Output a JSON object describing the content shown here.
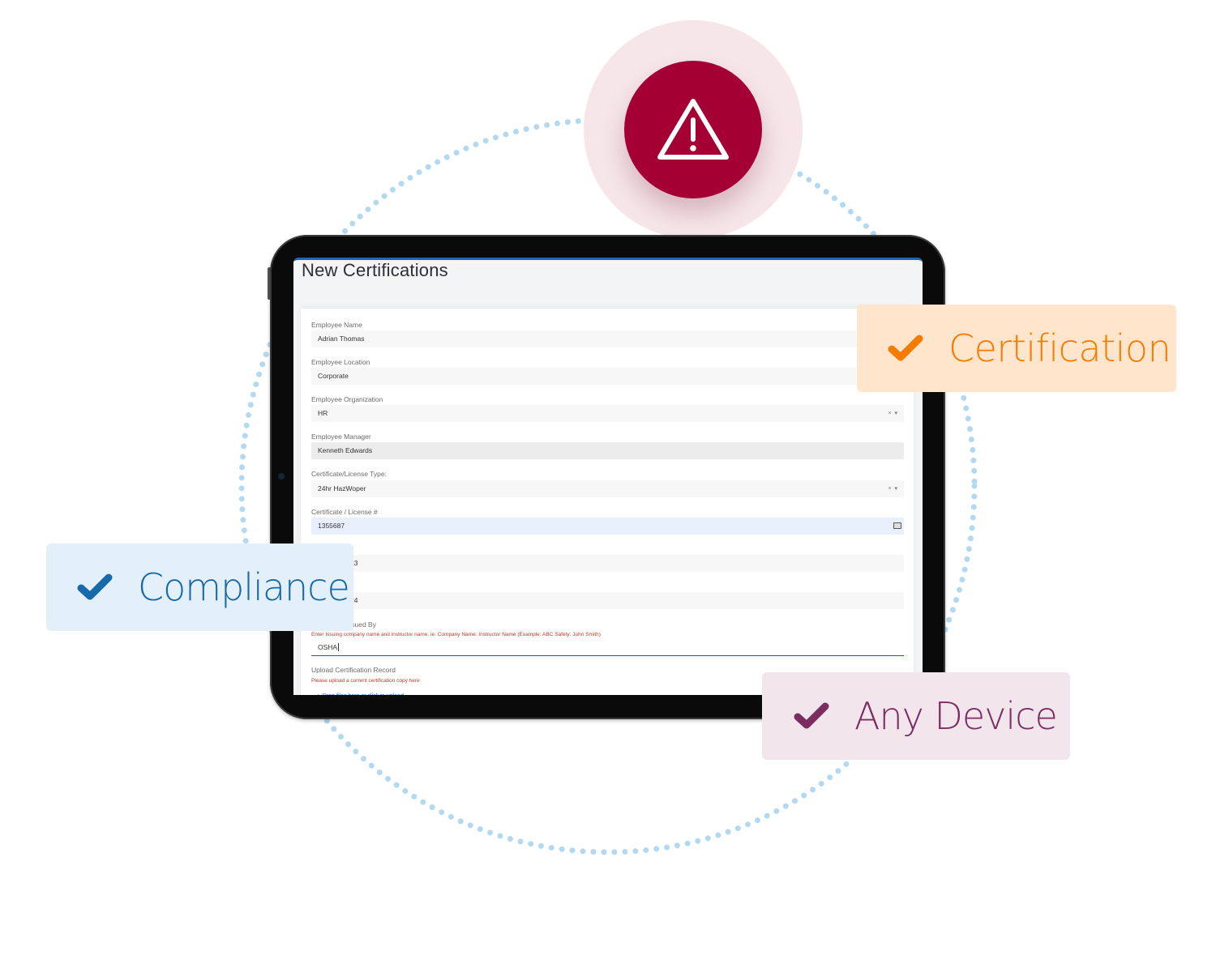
{
  "alert": {
    "icon": "warning-triangle-icon",
    "color": "#a50034",
    "halo_color": "#f6e6ea"
  },
  "ring": {
    "dot_color": "#b3d9f0"
  },
  "app": {
    "title": "New Certifications",
    "accent": "#1e63b8",
    "form": {
      "fields": [
        {
          "label": "Employee Name",
          "value": "Adrian Thomas",
          "type": "text"
        },
        {
          "label": "Employee Location",
          "value": "Corporate",
          "type": "text"
        },
        {
          "label": "Employee Organization",
          "value": "HR",
          "type": "select"
        },
        {
          "label": "Employee Manager",
          "value": "Kenneth Edwards",
          "type": "readonly"
        },
        {
          "label": "Certificate/License Type:",
          "value": "24hr HazWoper",
          "type": "select"
        },
        {
          "label": "Certificate / License #",
          "value": "1355687",
          "type": "text-active"
        },
        {
          "label": "",
          "value": "23",
          "type": "date-partial"
        },
        {
          "label": "",
          "value": "24",
          "type": "date-partial"
        },
        {
          "label": "ssued By",
          "hint": "Enter Issuing company name and instructor name. ie: Company Name: Instructor Name (Example: ABC Safety: John Smith)",
          "value": "OSHA",
          "type": "text-focused"
        }
      ],
      "upload": {
        "label": "Upload Certification Record",
        "hint": "Please upload a current certification copy here",
        "dropzone": "Drop files here or click to upload"
      },
      "select_clear_glyph": "×",
      "select_arrow_glyph": "▾"
    }
  },
  "badges": [
    {
      "label": "Certification",
      "icon": "checkmark-icon",
      "color": "#f57c00",
      "bg": "#ffe5cc"
    },
    {
      "label": "Compliance",
      "icon": "checkmark-icon",
      "color": "#1769aa",
      "bg": "#e3f0fa"
    },
    {
      "label": "Any Device",
      "icon": "checkmark-icon",
      "color": "#7b2d62",
      "bg": "#f2e5ec"
    }
  ]
}
